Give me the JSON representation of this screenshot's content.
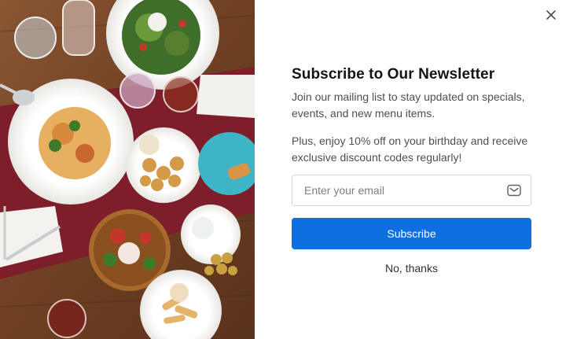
{
  "popup": {
    "title": "Subscribe to Our Newsletter",
    "description_1": "Join our mailing list to stay updated on specials, events, and new menu items.",
    "description_2": "Plus, enjoy 10% off on your birthday and receive exclusive discount codes regularly!",
    "email": {
      "placeholder": "Enter your email",
      "value": ""
    },
    "subscribe_label": "Subscribe",
    "decline_label": "No, thanks",
    "close_icon": "close-icon",
    "mail_icon": "mail-icon"
  },
  "colors": {
    "accent": "#0d6fe0",
    "title": "#111418",
    "body_text": "#4a4f57",
    "input_border": "#d3d6db",
    "table_wood": "#7a4a2c",
    "runner_red": "#7d1e2a"
  }
}
